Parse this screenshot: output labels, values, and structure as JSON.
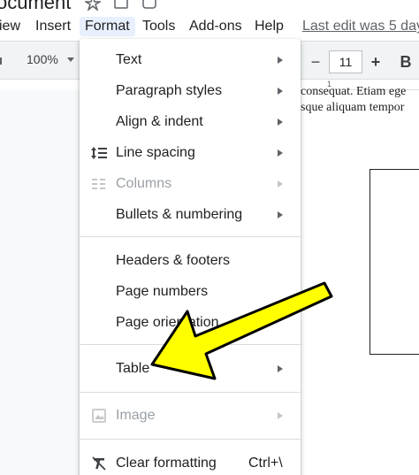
{
  "title_bar": {
    "doc_title": "ocument"
  },
  "menu_bar": {
    "items": [
      {
        "label": "iew"
      },
      {
        "label": "Insert"
      },
      {
        "label": "Format"
      },
      {
        "label": "Tools"
      },
      {
        "label": "Add-ons"
      },
      {
        "label": "Help"
      }
    ],
    "last_edit": "Last edit was 5 day"
  },
  "toolbar": {
    "zoom": "100%",
    "decrease_font": "−",
    "font_size": "11",
    "increase_font": "+",
    "bold": "B"
  },
  "ruler": {
    "mark": "1"
  },
  "document": {
    "line1": "consequat. Etiam ege",
    "line2": "sque aliquam tempor"
  },
  "format_menu": {
    "items": [
      {
        "label": "Text",
        "submenu": true,
        "disabled": false
      },
      {
        "label": "Paragraph styles",
        "submenu": true,
        "disabled": false
      },
      {
        "label": "Align & indent",
        "submenu": true,
        "disabled": false
      },
      {
        "label": "Line spacing",
        "submenu": true,
        "disabled": false,
        "icon": "line-spacing-icon"
      },
      {
        "label": "Columns",
        "submenu": true,
        "disabled": true,
        "icon": "columns-icon"
      },
      {
        "label": "Bullets & numbering",
        "submenu": true,
        "disabled": false
      },
      {
        "label": "Headers & footers",
        "submenu": false,
        "disabled": false
      },
      {
        "label": "Page numbers",
        "submenu": false,
        "disabled": false
      },
      {
        "label": "Page orientation",
        "submenu": false,
        "disabled": false
      },
      {
        "label": "Table",
        "submenu": true,
        "disabled": false
      },
      {
        "label": "Image",
        "submenu": true,
        "disabled": true,
        "icon": "image-icon"
      },
      {
        "label": "Clear formatting",
        "submenu": false,
        "disabled": false,
        "icon": "clear-formatting-icon",
        "shortcut": "Ctrl+\\"
      }
    ]
  },
  "colors": {
    "active_menu_bg": "#e8f0fe",
    "arrow_fill": "#ffff00",
    "arrow_stroke": "#000000",
    "disabled_text": "#9aa0a6"
  }
}
